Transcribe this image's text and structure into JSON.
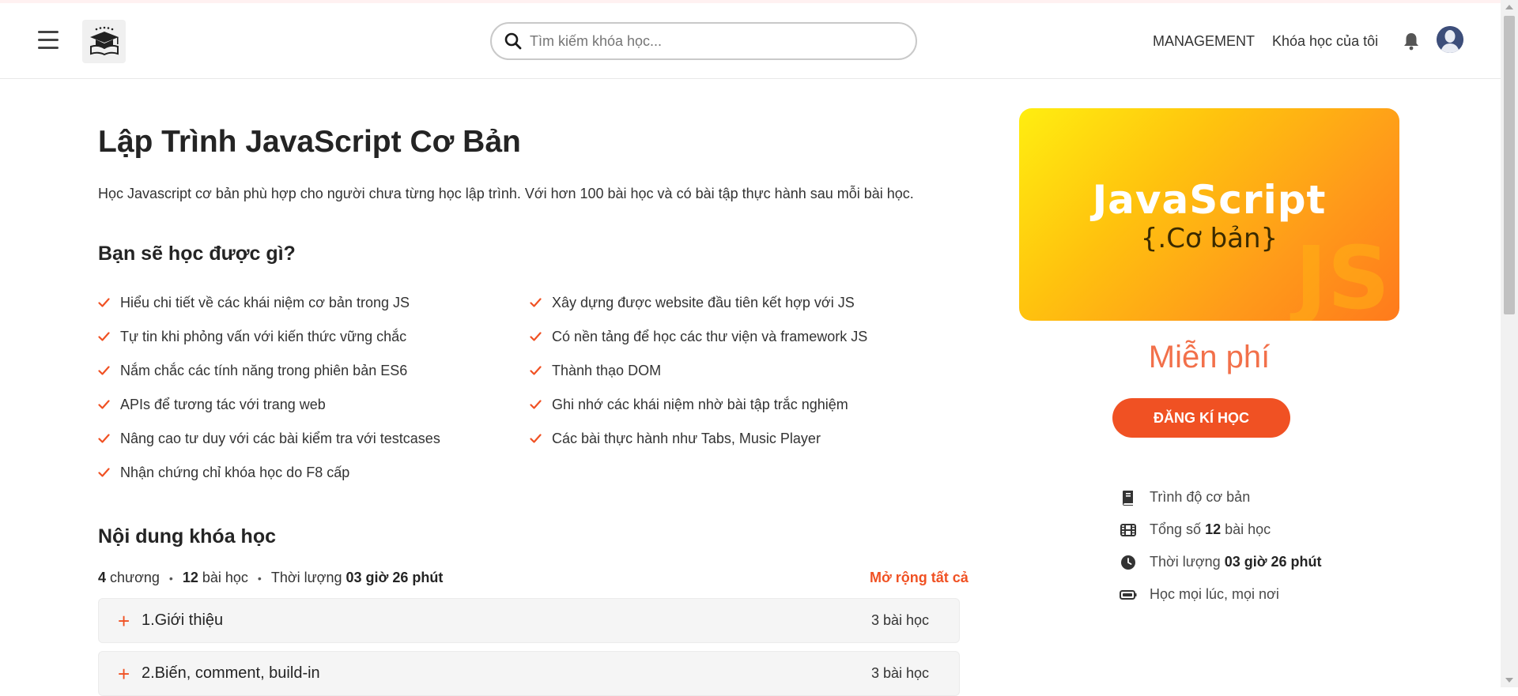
{
  "header": {
    "search_placeholder": "Tìm kiếm khóa học...",
    "nav_management": "MANAGEMENT",
    "nav_my_courses": "Khóa học của tôi"
  },
  "course": {
    "title": "Lập Trình JavaScript Cơ Bản",
    "description": "Học Javascript cơ bản phù hợp cho người chưa từng học lập trình. Với hơn 100 bài học và có bài tập thực hành sau mỗi bài học.",
    "learn_heading": "Bạn sẽ học được gì?",
    "learn_left": [
      "Hiểu chi tiết về các khái niệm cơ bản trong JS",
      "Tự tin khi phỏng vấn với kiến thức vững chắc",
      "Nắm chắc các tính năng trong phiên bản ES6",
      "APIs để tương tác với trang web",
      "Nâng cao tư duy với các bài kiểm tra với testcases",
      "Nhận chứng chỉ khóa học do F8 cấp"
    ],
    "learn_right": [
      "Xây dựng được website đầu tiên kết hợp với JS",
      "Có nền tảng để học các thư viện và framework JS",
      "Thành thạo DOM",
      "Ghi nhớ các khái niệm nhờ bài tập trắc nghiệm",
      "Các bài thực hành như Tabs, Music Player"
    ],
    "content_heading": "Nội dung khóa học",
    "meta": {
      "chapters_num": "4",
      "chapters_label": "chương",
      "lessons_num": "12",
      "lessons_label": "bài học",
      "duration_label": "Thời lượng",
      "duration_value": "03 giờ 26 phút"
    },
    "expand_all": "Mở rộng tất cả",
    "chapters": [
      {
        "title": "1.Giới thiệu",
        "count": "3 bài học"
      },
      {
        "title": "2.Biến, comment, build-in",
        "count": "3 bài học"
      }
    ]
  },
  "sidebar": {
    "thumb_title": "JavaScript",
    "thumb_subtitle": "{.Cơ bản}",
    "thumb_watermark": "JS",
    "price": "Miễn phí",
    "enroll_button": "ĐĂNG KÍ HỌC",
    "level": "Trình độ cơ bản",
    "total_label": "Tổng số",
    "total_num": "12",
    "total_unit": "bài học",
    "duration_label": "Thời lượng",
    "duration_value": "03 giờ 26 phút",
    "anywhere": "Học mọi lúc, mọi nơi"
  },
  "colors": {
    "accent": "#f05123",
    "thumb_gradient_start": "#ffee10",
    "thumb_gradient_end": "#ff7a1c"
  }
}
